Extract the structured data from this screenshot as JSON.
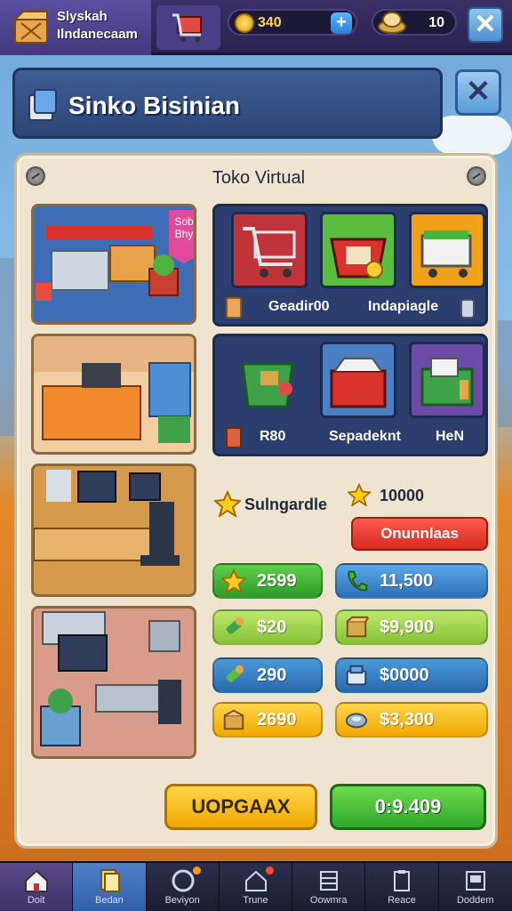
{
  "header": {
    "brand_line1": "Slyskah",
    "brand_line2": "Ilndanecaam",
    "coins": "340",
    "gems": "10",
    "plus_label": "+",
    "close_label": "✕"
  },
  "title_panel": {
    "title": "Sinko Bisinian",
    "close_label": "✕"
  },
  "panel": {
    "title": "Toko Virtual",
    "sale_badge": "Sob Bhy"
  },
  "shop_card_1": {
    "label_left": "Geadir00",
    "label_right": "Indapiagle"
  },
  "shop_card_2": {
    "label_1": "R80",
    "label_2": "Sepadeknt",
    "label_3": "HeN"
  },
  "stats": {
    "star_label": "Sulngardle",
    "star_value": "10000",
    "red_button": "Onunnlaas"
  },
  "values": [
    {
      "left": "2599",
      "right": "11,500"
    },
    {
      "left": "$20",
      "right": "$9,900"
    },
    {
      "left": "290",
      "right": "$0000"
    },
    {
      "left": "2690",
      "right": "$3,300"
    }
  ],
  "actions": {
    "upgrade": "UOPGAAX",
    "confirm": "0:9.409"
  },
  "nav": [
    {
      "label": "Doit"
    },
    {
      "label": "Bedan"
    },
    {
      "label": "Beviyon"
    },
    {
      "label": "Trune"
    },
    {
      "label": "Oowmra"
    },
    {
      "label": "Reace"
    },
    {
      "label": "Doddem"
    }
  ]
}
